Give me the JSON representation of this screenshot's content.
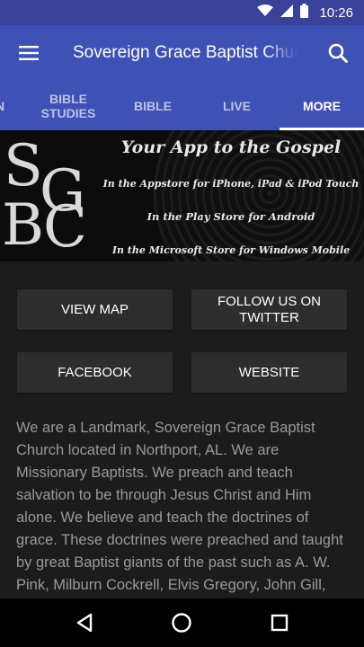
{
  "status_bar": {
    "time": "10:26",
    "icons": [
      "wifi-icon",
      "signal-icon",
      "battery-icon"
    ]
  },
  "app_bar": {
    "title": "Sovereign Grace Baptist Church",
    "menu_icon": "hamburger-menu-icon",
    "search_icon": "search-icon"
  },
  "tabs": [
    {
      "label": "N",
      "active": false
    },
    {
      "label": "BIBLE STUDIES",
      "active": false
    },
    {
      "label": "BIBLE",
      "active": false
    },
    {
      "label": "LIVE",
      "active": false
    },
    {
      "label": "MORE",
      "active": true
    }
  ],
  "banner": {
    "logo": "SGBC",
    "headline": "Your App to the Gospel",
    "lines": [
      "In the Appstore for iPhone, iPad & iPod Touch",
      "In the Play Store for Android",
      "In the Microsoft Store for Windows Mobile"
    ]
  },
  "buttons": {
    "view_map": "VIEW MAP",
    "follow_twitter": "FOLLOW US ON TWITTER",
    "facebook": "FACEBOOK",
    "website": "WEBSITE"
  },
  "about_text": "We are a Landmark, Sovereign Grace Baptist Church located in Northport, AL.  We are Missionary Baptists.  We preach and teach salvation to be through Jesus Christ and Him alone.  We believe and teach the doctrines of grace.  These doctrines were preached and taught by great Baptist giants of the past such as A. W. Pink, Milburn Cockrell, Elvis Gregory, John Gill, Charles Spurgeon and a host of others.",
  "nav_bar": {
    "back_icon": "back-triangle-icon",
    "home_icon": "home-circle-icon",
    "recents_icon": "recents-square-icon"
  },
  "colors": {
    "primary": "#3f51b5",
    "status_bar": "#3a4199",
    "background": "#1c1c1c",
    "button": "#2d2d2d",
    "body_text": "#9a9a9a"
  }
}
